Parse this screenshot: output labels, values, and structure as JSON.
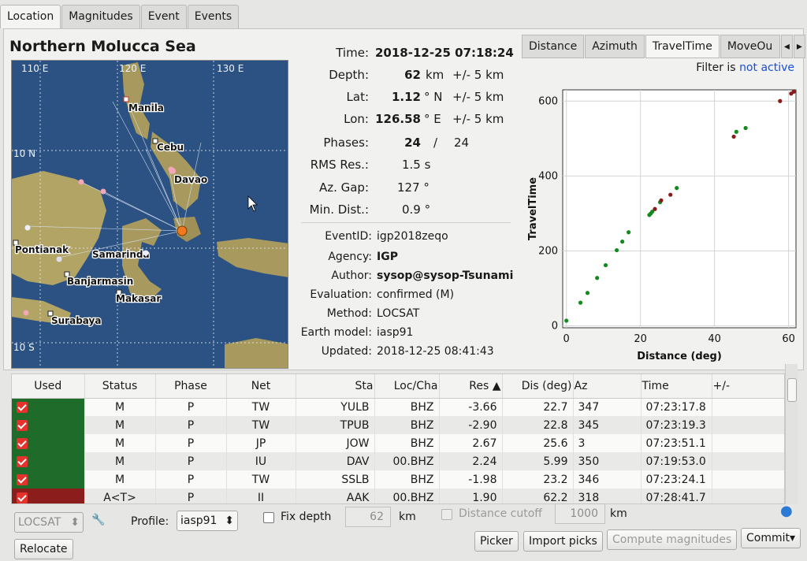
{
  "tabs": [
    "Location",
    "Magnitudes",
    "Event",
    "Events"
  ],
  "region": "Northern Molucca Sea",
  "map": {
    "grid_labels": [
      "110 E",
      "120 E",
      "130 E",
      "10 N",
      "10 S"
    ],
    "cities": [
      "Manila",
      "Cebu",
      "Davao",
      "Pontianak",
      "Samarinda",
      "Banjarmasin",
      "Makasar",
      "Surabaya"
    ]
  },
  "origin": {
    "time_label": "Time:",
    "time": "2018-12-25 07:18:24",
    "depth_label": "Depth:",
    "depth": "62",
    "depth_unit": "km",
    "depth_unc": "+/- 5 km",
    "lat_label": "Lat:",
    "lat": "1.12",
    "lat_unit": "° N",
    "lat_unc": "+/- 5 km",
    "lon_label": "Lon:",
    "lon": "126.58",
    "lon_unit": "° E",
    "lon_unc": "+/- 5 km",
    "phases_label": "Phases:",
    "phases_used": "24",
    "phases_sep": "/",
    "phases_total": "24",
    "rms_label": "RMS Res.:",
    "rms": "1.5 s",
    "gap_label": "Az. Gap:",
    "gap": "127 °",
    "mindist_label": "Min. Dist.:",
    "mindist": "0.9 °"
  },
  "meta": {
    "eventid_label": "EventID:",
    "eventid": "igp2018zeqo",
    "agency_label": "Agency:",
    "agency": "IGP",
    "author_label": "Author:",
    "author": "sysop@sysop-Tsunami",
    "evaluation_label": "Evaluation:",
    "evaluation": "confirmed (M)",
    "method_label": "Method:",
    "method": "LOCSAT",
    "earthmodel_label": "Earth model:",
    "earthmodel": "iasp91",
    "updated_label": "Updated:",
    "updated": "2018-12-25 08:41:43"
  },
  "plot_tabs": [
    "Distance",
    "Azimuth",
    "TravelTime",
    "MoveOu"
  ],
  "filter": {
    "prefix": "Filter is",
    "state": "not active"
  },
  "chart_data": {
    "type": "scatter",
    "xlabel": "Distance (deg)",
    "ylabel": "TravelTime",
    "xlim": [
      -1,
      62
    ],
    "ylim": [
      -5,
      630
    ],
    "xticks": [
      0,
      20,
      40,
      60
    ],
    "yticks": [
      0,
      200,
      400,
      600
    ],
    "grid": true,
    "series": [
      {
        "color": "#138a1f",
        "points": [
          [
            0,
            14
          ],
          [
            3.8,
            62
          ],
          [
            5.7,
            88
          ],
          [
            8.3,
            128
          ],
          [
            10.6,
            162
          ],
          [
            13.6,
            202
          ],
          [
            15.1,
            225
          ],
          [
            16.8,
            250
          ],
          [
            22.4,
            296
          ],
          [
            22.8,
            300
          ],
          [
            23.2,
            305
          ],
          [
            25.3,
            330
          ],
          [
            29.8,
            368
          ],
          [
            45.9,
            518
          ],
          [
            48.4,
            528
          ]
        ]
      },
      {
        "color": "#8b1a1a",
        "points": [
          [
            23.9,
            312
          ],
          [
            25.6,
            335
          ],
          [
            28.1,
            350
          ],
          [
            45.2,
            505
          ],
          [
            57.7,
            600
          ],
          [
            60.7,
            620
          ],
          [
            61.4,
            625
          ]
        ]
      }
    ]
  },
  "table": {
    "headers": [
      "Used",
      "Status",
      "Phase",
      "Net",
      "Sta",
      "Loc/Cha",
      "Res ▲",
      "Dis (deg)",
      "Az",
      "Time",
      "+/-"
    ],
    "rows": [
      [
        "M",
        "P",
        "TW",
        "YULB",
        "BHZ",
        "-3.66",
        "22.7",
        "347",
        "07:23:17.8",
        ""
      ],
      [
        "M",
        "P",
        "TW",
        "TPUB",
        "BHZ",
        "-2.90",
        "22.8",
        "345",
        "07:23:19.3",
        ""
      ],
      [
        "M",
        "P",
        "JP",
        "JOW",
        "BHZ",
        "2.67",
        "25.6",
        "3",
        "07:23:51.1",
        ""
      ],
      [
        "M",
        "P",
        "IU",
        "DAV",
        "00.BHZ",
        "2.24",
        "5.99",
        "350",
        "07:19:53.0",
        ""
      ],
      [
        "M",
        "P",
        "TW",
        "SSLB",
        "BHZ",
        "-1.98",
        "23.2",
        "346",
        "07:23:24.1",
        ""
      ],
      [
        "A<T>",
        "P",
        "II",
        "AAK",
        "00.BHZ",
        "1.90",
        "62.2",
        "318",
        "07:28:41.7",
        ""
      ]
    ]
  },
  "controls": {
    "locator": "LOCSAT",
    "profile_label": "Profile:",
    "profile": "iasp91",
    "fixdepth_label": "Fix depth",
    "fixdepth_value": "62",
    "fixdepth_unit": "km",
    "cutoff_label": "Distance cutoff",
    "cutoff_value": "1000",
    "cutoff_unit": "km",
    "relocate": "Relocate",
    "picker": "Picker",
    "import_picks": "Import picks",
    "compute_magnitudes": "Compute magnitudes",
    "commit": "Commit"
  }
}
